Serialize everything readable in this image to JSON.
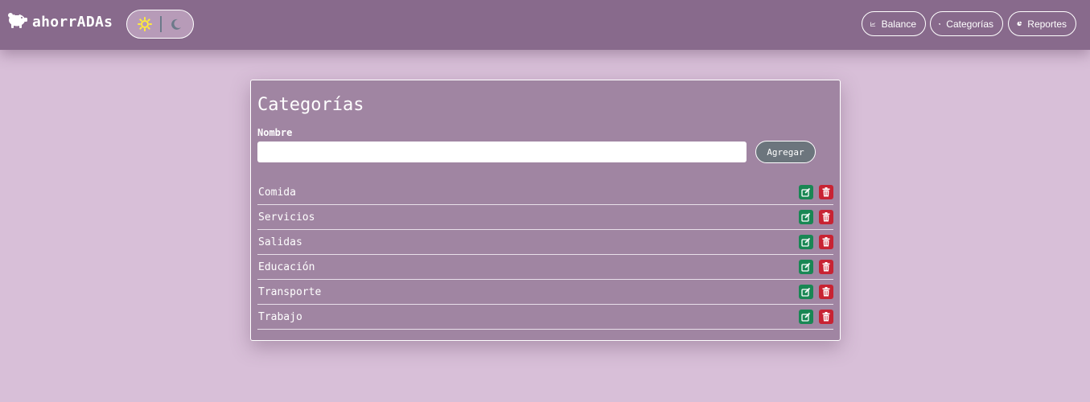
{
  "brand": {
    "title": "ahorrADAs",
    "logo_icon": "piggy-bank-icon"
  },
  "theme_toggle": {
    "light_icon": "sun-icon",
    "dark_icon": "moon-icon",
    "sun_color": "#ffeb3b"
  },
  "nav": [
    {
      "label": "Balance",
      "icon": "chart-line-icon"
    },
    {
      "label": "Categorías",
      "icon": "tag-icon"
    },
    {
      "label": "Reportes",
      "icon": "pie-chart-icon"
    }
  ],
  "categories_panel": {
    "title": "Categorías",
    "name_label": "Nombre",
    "name_value": "",
    "add_button": "Agregar",
    "items": [
      {
        "name": "Comida"
      },
      {
        "name": "Servicios"
      },
      {
        "name": "Salidas"
      },
      {
        "name": "Educación"
      },
      {
        "name": "Transporte"
      },
      {
        "name": "Trabajo"
      }
    ]
  },
  "colors": {
    "page_bg": "#d8bfd8",
    "navbar_bg": "#886a8c",
    "card_bg": "#a085a2",
    "edit": "#198754",
    "delete": "#c82333",
    "add_button": "#6c757d"
  }
}
